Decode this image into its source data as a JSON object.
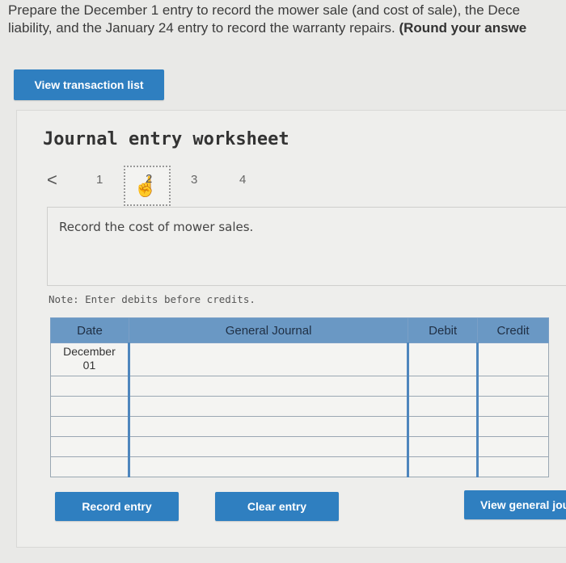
{
  "prompt": {
    "line1": "Prepare the December 1 entry to record the mower sale (and cost of sale), the Dece",
    "line2_normal": "liability, and the January 24 entry to record the warranty repairs. ",
    "line2_bold": "(Round your answe"
  },
  "view_transaction_label": "View transaction list",
  "worksheet": {
    "title": "Journal entry worksheet",
    "pager": {
      "prev_glyph": "<",
      "pages": [
        "1",
        "2",
        "3",
        "4"
      ],
      "active_page": "2"
    },
    "instruction": "Record the cost of mower sales.",
    "note": "Note: Enter debits before credits."
  },
  "journal_table": {
    "headers": {
      "date": "Date",
      "general_journal": "General Journal",
      "debit": "Debit",
      "credit": "Credit"
    },
    "rows": [
      {
        "date": "December\n01",
        "account": "",
        "debit": "",
        "credit": ""
      },
      {
        "date": "",
        "account": "",
        "debit": "",
        "credit": ""
      },
      {
        "date": "",
        "account": "",
        "debit": "",
        "credit": ""
      },
      {
        "date": "",
        "account": "",
        "debit": "",
        "credit": ""
      },
      {
        "date": "",
        "account": "",
        "debit": "",
        "credit": ""
      },
      {
        "date": "",
        "account": "",
        "debit": "",
        "credit": ""
      }
    ]
  },
  "buttons": {
    "record": "Record entry",
    "clear": "Clear entry",
    "view_general": "View general jou"
  },
  "colors": {
    "accent": "#2f7fc0",
    "header": "#6a98c4"
  }
}
